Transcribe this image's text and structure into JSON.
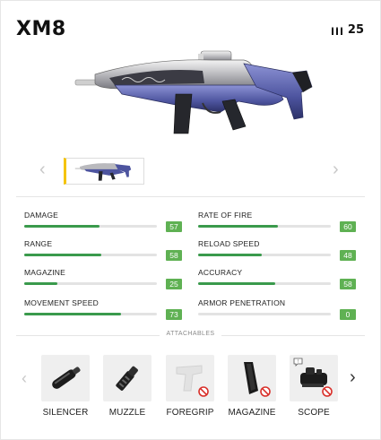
{
  "weapon": {
    "name": "XM8",
    "ammo": "25"
  },
  "carousel": {
    "prev_icon": "chevron-left-icon",
    "next_icon": "chevron-right-icon"
  },
  "stats": [
    {
      "label": "DAMAGE",
      "value": "57",
      "fill": 0.57
    },
    {
      "label": "RATE OF FIRE",
      "value": "60",
      "fill": 0.6
    },
    {
      "label": "RANGE",
      "value": "58",
      "fill": 0.58
    },
    {
      "label": "RELOAD SPEED",
      "value": "48",
      "fill": 0.48
    },
    {
      "label": "MAGAZINE",
      "value": "25",
      "fill": 0.25
    },
    {
      "label": "ACCURACY",
      "value": "58",
      "fill": 0.58
    },
    {
      "label": "MOVEMENT SPEED",
      "value": "73",
      "fill": 0.73
    },
    {
      "label": "ARMOR PENETRATION",
      "value": "0",
      "fill": 0.0
    }
  ],
  "attachables": {
    "title": "ATTACHABLES",
    "items": [
      {
        "label": "SILENCER",
        "available": true
      },
      {
        "label": "MUZZLE",
        "available": true
      },
      {
        "label": "FOREGRIP",
        "available": false
      },
      {
        "label": "MAGAZINE",
        "available": false
      },
      {
        "label": "SCOPE",
        "available": false
      }
    ]
  },
  "colors": {
    "stat_fill": "#3a9a4c",
    "stat_badge": "#5fb153",
    "selected_accent": "#f5c400",
    "unavailable": "#d9302a"
  }
}
